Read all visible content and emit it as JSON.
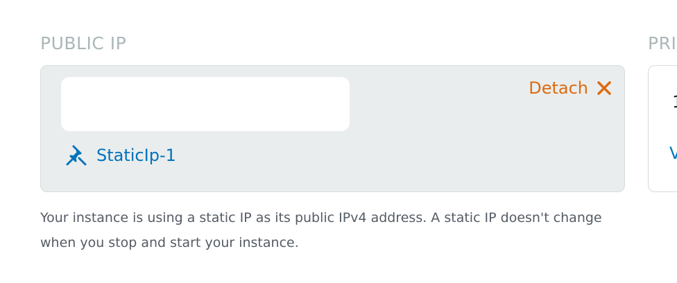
{
  "public_ip": {
    "label": "PUBLIC IP",
    "address": "",
    "detach_label": "Detach",
    "static_ip_name": "StaticIp-1",
    "description": "Your instance is using a static IP as its public IPv4 address. A static IP doesn't change when you stop and start your instance."
  },
  "private_ip": {
    "label": "PRI",
    "value_fragment": "1",
    "link_fragment": "V"
  },
  "icons": {
    "detach": "close-x-icon",
    "static_ip": "pin-icon"
  },
  "colors": {
    "accent_orange": "#dd6b10",
    "link_blue": "#0073bb",
    "muted_label": "#aab7b8",
    "card_background": "#eaeded"
  }
}
